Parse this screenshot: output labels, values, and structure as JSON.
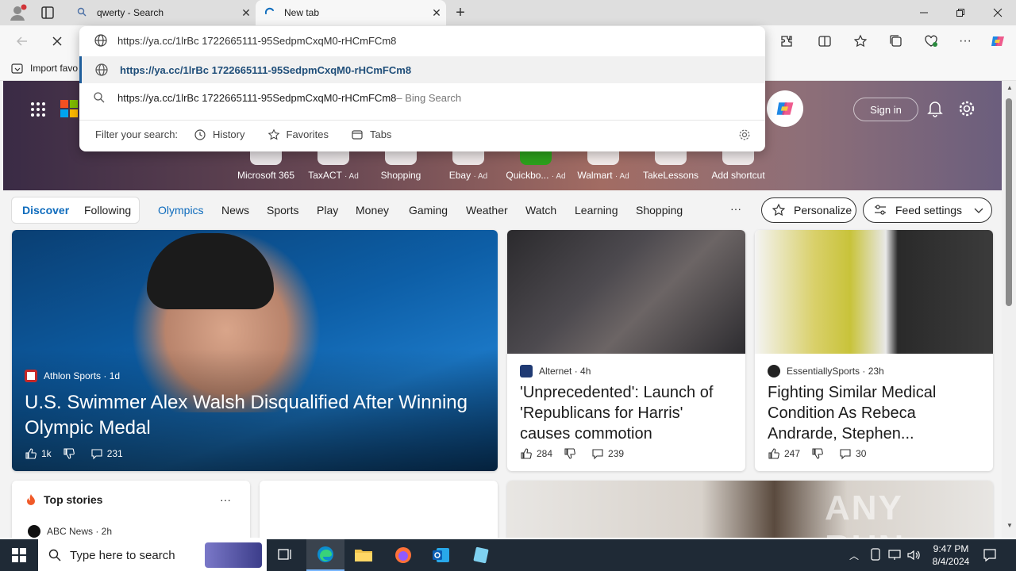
{
  "browser": {
    "tabs": [
      {
        "title": "qwerty - Search"
      },
      {
        "title": "New tab"
      }
    ],
    "address": "https://ya.cc/1lrBc 1722665111-95SedpmCxqM0-rHCmFCm8",
    "favorites_bar": {
      "import_label": "Import favo"
    }
  },
  "omnibox": {
    "suggestions": [
      {
        "text": "https://ya.cc/1lrBc 1722665111-95SedpmCxqM0-rHCmFCm8",
        "suffix": ""
      },
      {
        "text": "https://ya.cc/1lrBc 1722665111-95SedpmCxqM0-rHCmFCm8",
        "suffix": " – Bing Search"
      }
    ],
    "filter_label": "Filter your search:",
    "filters": [
      "History",
      "Favorites",
      "Tabs"
    ]
  },
  "page": {
    "sign_in": "Sign in",
    "shortcuts": [
      {
        "label": "Microsoft 365",
        "ad": ""
      },
      {
        "label": "TaxACT",
        "ad": "· Ad"
      },
      {
        "label": "Shopping",
        "ad": ""
      },
      {
        "label": "Ebay",
        "ad": "· Ad"
      },
      {
        "label": "Quickbo...",
        "ad": "· Ad"
      },
      {
        "label": "Walmart",
        "ad": "· Ad"
      },
      {
        "label": "TakeLessons",
        "ad": ""
      },
      {
        "label": "Add shortcut",
        "ad": ""
      }
    ],
    "nav": {
      "discover": "Discover",
      "following": "Following",
      "items": [
        "Olympics",
        "News",
        "Sports",
        "Play",
        "Money",
        "Gaming",
        "Weather",
        "Watch",
        "Learning",
        "Shopping"
      ],
      "more": "···",
      "personalize": "Personalize",
      "feed_settings": "Feed settings"
    },
    "cards": [
      {
        "source": "Athlon Sports · 1d",
        "headline": "U.S. Swimmer Alex Walsh Disqualified After Winning Olympic Medal",
        "likes": "1k",
        "comments": "231"
      },
      {
        "source": "Alternet · 4h",
        "headline": "'Unprecedented': Launch of 'Republicans for Harris' causes commotion",
        "likes": "284",
        "comments": "239"
      },
      {
        "source": "EssentiallySports · 23h",
        "headline": "Fighting Similar Medical Condition As Rebeca Andrarde, Stephen...",
        "likes": "247",
        "comments": "30"
      }
    ],
    "top_stories": {
      "title": "Top stories",
      "more": "···",
      "first_source": "ABC News · 2h"
    },
    "watermark": "ANY RUN"
  },
  "taskbar": {
    "search_placeholder": "Type here to search",
    "time": "9:47 PM",
    "date": "8/4/2024"
  },
  "colors": {
    "accent": "#0f6cbd",
    "taskbar": "#1f2a36",
    "link": "#1f4e79"
  }
}
